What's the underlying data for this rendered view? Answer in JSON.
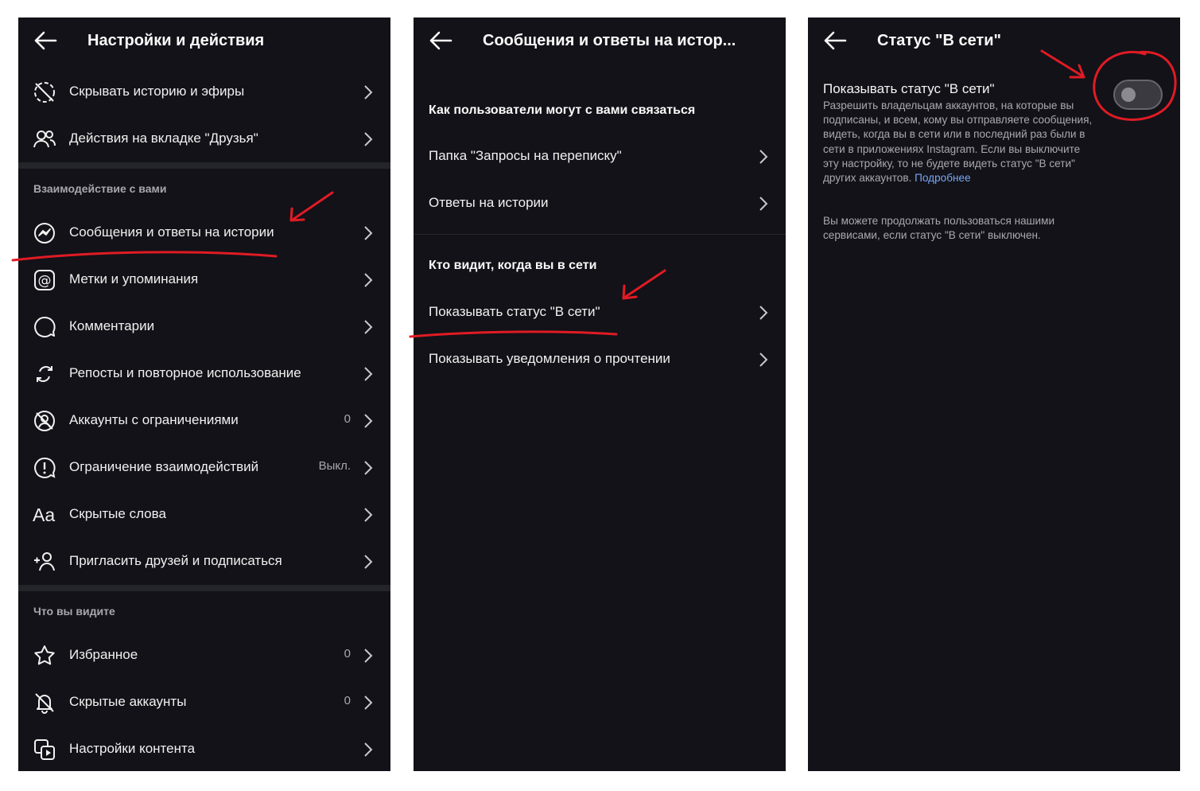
{
  "colors": {
    "panel_bg": "#121218",
    "separator": "#24242b",
    "muted": "#a7a7ad",
    "link": "#7aa6f5",
    "annotation": "#e01b24"
  },
  "panel1": {
    "title": "Настройки и действия",
    "rows_top": [
      {
        "icon": "hide-story-icon",
        "label": "Скрывать историю и эфиры",
        "value": ""
      },
      {
        "icon": "friends-icon",
        "label": "Действия на вкладке \"Друзья\"",
        "value": ""
      }
    ],
    "section1": "Взаимодействие с вами",
    "rows_interact": [
      {
        "icon": "messenger-icon",
        "label": "Сообщения и ответы на истории",
        "value": ""
      },
      {
        "icon": "at-sign-icon",
        "label": "Метки и упоминания",
        "value": ""
      },
      {
        "icon": "comment-icon",
        "label": "Комментарии",
        "value": ""
      },
      {
        "icon": "repost-icon",
        "label": "Репосты и повторное использование",
        "value": ""
      },
      {
        "icon": "restricted-icon",
        "label": "Аккаунты с ограничениями",
        "value": "0"
      },
      {
        "icon": "limit-icon",
        "label": "Ограничение взаимодействий",
        "value": "Выкл."
      },
      {
        "icon": "hidden-words-icon",
        "label": "Скрытые слова",
        "value": ""
      },
      {
        "icon": "invite-icon",
        "label": "Пригласить друзей и подписаться",
        "value": ""
      }
    ],
    "section2": "Что вы видите",
    "rows_see": [
      {
        "icon": "star-icon",
        "label": "Избранное",
        "value": "0"
      },
      {
        "icon": "muted-bell-icon",
        "label": "Скрытые аккаунты",
        "value": "0"
      },
      {
        "icon": "content-settings-icon",
        "label": "Настройки контента",
        "value": ""
      }
    ],
    "hidden_words_glyph": "Aa"
  },
  "panel2": {
    "title": "Сообщения и ответы на истор...",
    "subheader1": "Как пользователи могут с вами связаться",
    "rows1": [
      {
        "label": "Папка \"Запросы на переписку\""
      },
      {
        "label": "Ответы на истории"
      }
    ],
    "subheader2": "Кто видит, когда вы в сети",
    "rows2": [
      {
        "label": "Показывать статус \"В сети\""
      },
      {
        "label": "Показывать уведомления о прочтении"
      }
    ]
  },
  "panel3": {
    "title": "Статус \"В сети\"",
    "setting_title": "Показывать статус \"В сети\"",
    "description": "Разрешить владельцам аккаунтов, на которые вы подписаны, и всем, кому вы отправляете сообщения, видеть, когда вы в сети или в последний раз были в сети в приложениях Instagram. Если вы выключите эту настройку, то не будете видеть статус \"В сети\" других аккаунтов.",
    "link": "Подробнее",
    "note": "Вы можете продолжать пользоваться нашими сервисами, если статус \"В сети\" выключен.",
    "toggle_on": false
  }
}
